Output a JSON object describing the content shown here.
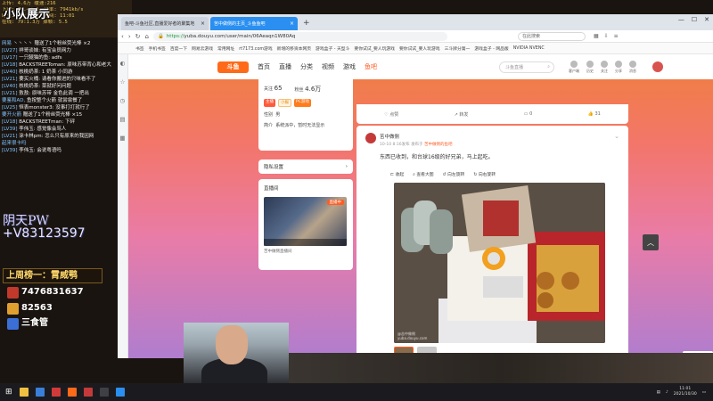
{
  "overlay": {
    "title": "小队展示",
    "stats": [
      "上传:  4.6万      缓速:216",
      "下载:  79.4Kb/s   码率: 7941kb/s",
      "时长: 01:21:53   时间: 11:01",
      "在线: 79:1.3万   掉帧: 5.5"
    ],
    "chat": [
      {
        "lv": "网易",
        "text": "丶丶丶丶 赠送了1个粉丝荧光棒 ×2"
      },
      {
        "lv": "[LV27]",
        "text": "祥哥谈妹: 有宝会员网力"
      },
      {
        "lv": "[LV17]",
        "text": "一只腿猫的鱼: adfs"
      },
      {
        "lv": "[LV18]",
        "text": "BACKSTREEToman: 原味苏带背心和老大"
      },
      {
        "lv": "[LV40]",
        "text": "核桃奶茶: 1 奶茶 小同游"
      },
      {
        "lv": "[LV21]",
        "text": "要买火桶: 请看你搬进的只味看不了"
      },
      {
        "lv": "[LV40]",
        "text": "核桃奶茶: 菜就好问问题"
      },
      {
        "lv": "[LV21]",
        "text": "敖敖: 原味苏带 金色此调 一把出"
      },
      {
        "lv": "要鉴和AD,",
        "text": "鱼按整个火箭 就尝尝餐了"
      },
      {
        "lv": "[LV25]",
        "text": "恒表monster3: 没事打打就行了"
      },
      {
        "lv": "要开火箭",
        "text": "赠送了1个粉丝荧光棒 ×15"
      },
      {
        "lv": "[LV18]",
        "text": "BACKSTREETman: 下砰"
      },
      {
        "lv": "[LV39]",
        "text": "李伟玉: 感觉像会骂人"
      },
      {
        "lv": "[LV21]",
        "text": "涂卡林pm: 怎么只有原来的我因网"
      },
      {
        "lv": "起来很卡吗",
        "text": ""
      },
      {
        "lv": "[LV39]",
        "text": "李伟玉: 会说粤语吗"
      }
    ],
    "brand_line1": "阴天PW",
    "brand_line2": "+V83123597",
    "rank_title": "上周榜一：霄威鹗",
    "ranks": [
      {
        "label": "7476831637",
        "color": "#c0392b"
      },
      {
        "label": "82563",
        "color": "#e0a030"
      },
      {
        "label": "三食管",
        "color": "#3b6fd6"
      }
    ]
  },
  "browser": {
    "tabs": [
      {
        "label": "鱼吧-斗鱼社区,直播爱好者的聚集地",
        "active": false
      },
      {
        "label": "苦中做侧的主页_斗鱼鱼吧",
        "active": true
      }
    ],
    "new_tab": "+",
    "url_scheme": "https://",
    "url_rest": "yuba.douyu.com/user/main/06Aeaqn1W80Aq",
    "search_placeholder": "在此搜索",
    "bookmarks": [
      "书签",
      "手机书签",
      "百度一下",
      "网易云游戏",
      "常用网址",
      "rt7173.com游戏",
      "新增的移资本网页",
      "游戏盒子 - 天型斗",
      "要你试试_要人玩游戏",
      "要你试试_要人玩游戏",
      "三斗牌分第一",
      "游戏盒子 - 网品版",
      "NVIDIA NVENC"
    ],
    "window_controls": [
      "—",
      "☐",
      "✕"
    ]
  },
  "douyu": {
    "logo": "斗鱼",
    "nav": [
      {
        "label": "首页",
        "active": false
      },
      {
        "label": "直播",
        "active": false
      },
      {
        "label": "分类",
        "active": false
      },
      {
        "label": "视频",
        "active": false
      },
      {
        "label": "游戏",
        "active": false
      },
      {
        "label": "鱼吧",
        "active": true
      }
    ],
    "search_placeholder": "斗鱼直播",
    "header_icons": [
      "客户端",
      "历史",
      "关注",
      "分享",
      "消息"
    ],
    "profile": {
      "follow_label": "关注",
      "follow_count": "65",
      "fans_label": "粉丝",
      "fans_count": "4.6万",
      "badges": [
        "主播",
        "小报",
        "PC游戏"
      ],
      "gender_label": "性别",
      "gender_value": "男",
      "intro_label": "简介",
      "intro_value": "系统派中，暂时无法显示"
    },
    "privacy_label": "隐私设置",
    "live": {
      "label": "直播间",
      "tag": "直播中",
      "caption": "苦中做侧直播间"
    },
    "actions": [
      {
        "label": "点赞",
        "icon": "like-icon"
      },
      {
        "label": "转发",
        "icon": "share-icon"
      },
      {
        "label": "0",
        "icon": "comment-icon"
      },
      {
        "label": "31",
        "icon": "thumbs-up-icon"
      }
    ],
    "post": {
      "author": "苦中做侧",
      "time": "10-10 8:16发布",
      "group_prefix": "发布于",
      "group": "苦中做侧的鱼吧",
      "text": "东西已收到，和台球16级的好兄弟，马上起吃。",
      "image_tools": [
        "收起",
        "查看大图",
        "向左旋转",
        "向右旋转"
      ],
      "image_caption_1": "@苦中做侧",
      "image_caption_2": "yuba.douyu.com"
    },
    "feedback_label": "意见反馈",
    "scroll_up": "︿"
  },
  "taskbar": {
    "time": "11:01",
    "date": "2021/10/30"
  }
}
